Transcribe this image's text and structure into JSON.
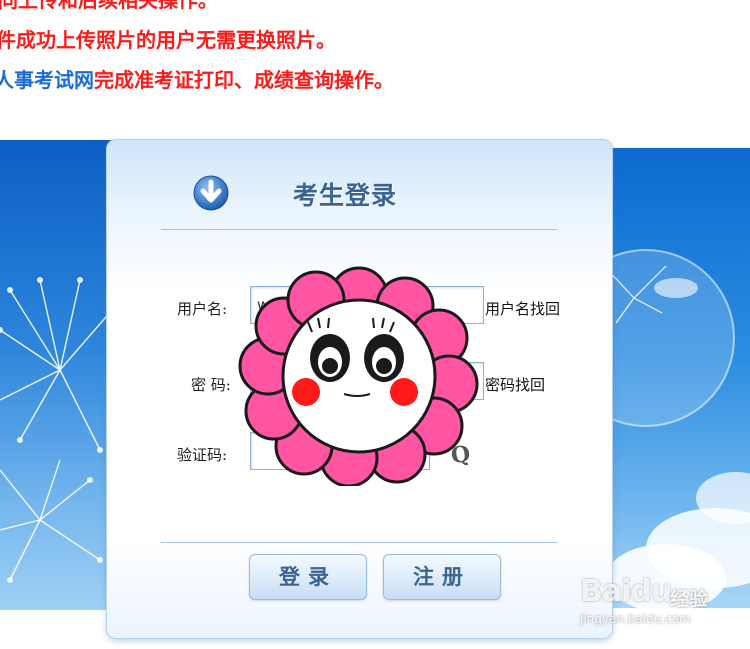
{
  "notices": {
    "line1": "同上传和后续相关操作。",
    "line2": "件成功上传照片的用户无需更换照片。",
    "line3_link": "人事考试网",
    "line3_rest": "完成准考证打印、成绩查询操作。"
  },
  "login": {
    "title": "考生登录",
    "username_label": "用户名:",
    "username_value": "w",
    "password_label": "密 码:",
    "captcha_label": "验证码:",
    "captcha_text": "Q",
    "recover_username": "用户名找回",
    "recover_password": "密码找回",
    "login_button": "登录",
    "register_button": "注册"
  },
  "watermark": {
    "logo": "Baidu",
    "product": "经验",
    "url": "jingyan.baidu.com"
  },
  "colors": {
    "notice_red": "#ff1a1a",
    "link_blue": "#1a6cd8",
    "title_blue": "#3a6491",
    "sticker_pink": "#ff4fa0"
  },
  "icons": [
    "download-arrow-icon",
    "flower-sticker"
  ]
}
